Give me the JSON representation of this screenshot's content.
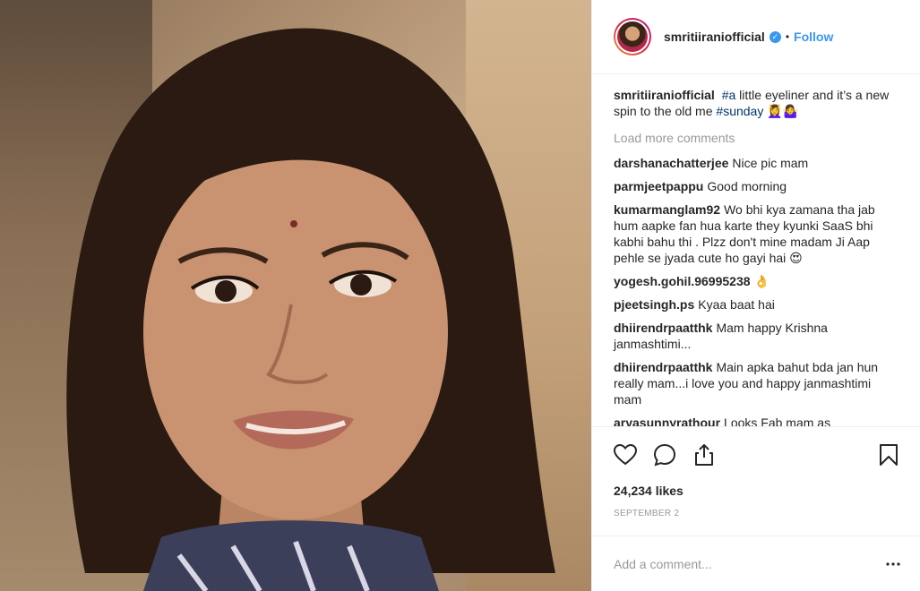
{
  "header": {
    "username": "smritiiraniofficial",
    "verified_glyph": "✓",
    "separator": "•",
    "follow_label": "Follow"
  },
  "caption": {
    "username": "smritiiraniofficial",
    "parts": [
      {
        "type": "hashtag",
        "text": "#a"
      },
      {
        "type": "text",
        "text": " little eyeliner and it’s a new spin to the old me "
      },
      {
        "type": "hashtag",
        "text": "#sunday"
      },
      {
        "type": "text",
        "text": " 💆‍♀️🤷‍♀️"
      }
    ]
  },
  "load_more_label": "Load more comments",
  "comments": [
    {
      "user": "darshanachatterjee",
      "text": "Nice pic mam"
    },
    {
      "user": "parmjeetpappu",
      "text": "Good morning"
    },
    {
      "user": "kumarmanglam92",
      "text": "Wo bhi kya zamana tha jab hum aapke fan hua karte they kyunki SaaS bhi kabhi bahu thi . Plzz don't mine madam Ji Aap pehle se jyada cute ho gayi hai 😍"
    },
    {
      "user": "yogesh.gohil.96995238",
      "text": "👌"
    },
    {
      "user": "pjeetsingh.ps",
      "text": "Kyaa baat hai"
    },
    {
      "user": "dhiirendrpaatthk",
      "text": "Mam happy Krishna janmashtimi..."
    },
    {
      "user": "dhiirendrpaatthk",
      "text": "Main apka bahut bda jan hun really mam...i love you and happy janmashtimi mam"
    },
    {
      "user": "aryasunnyrathour",
      "text": "Looks Fab mam as"
    }
  ],
  "actions": {
    "like_icon": "heart-icon",
    "comment_icon": "comment-icon",
    "share_icon": "share-icon",
    "save_icon": "bookmark-icon"
  },
  "likes_text": "24,234 likes",
  "date_text": "SEPTEMBER 2",
  "add_comment": {
    "placeholder": "Add a comment...",
    "more_glyph": "•••"
  },
  "colors": {
    "accent": "#3897f0",
    "hashtag": "#003569",
    "muted": "#999999"
  }
}
